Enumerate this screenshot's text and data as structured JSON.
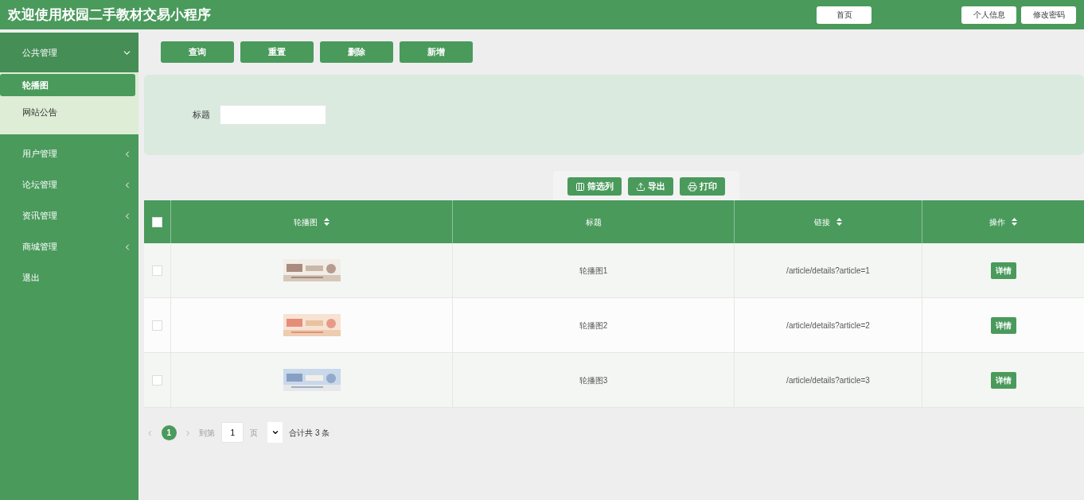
{
  "header": {
    "title": "欢迎使用校园二手教材交易小程序",
    "home_button": "首页",
    "profile_button": "个人信息",
    "password_button": "修改密码"
  },
  "sidebar": {
    "items": [
      {
        "label": "公共管理",
        "kind": "group",
        "expanded": true,
        "children": [
          {
            "label": "轮播图",
            "selected": true
          },
          {
            "label": "网站公告",
            "selected": false
          }
        ]
      },
      {
        "label": "用户管理",
        "kind": "group",
        "expanded": false
      },
      {
        "label": "论坛管理",
        "kind": "group",
        "expanded": false
      },
      {
        "label": "资讯管理",
        "kind": "group",
        "expanded": false
      },
      {
        "label": "商城管理",
        "kind": "group",
        "expanded": false
      },
      {
        "label": "退出",
        "kind": "link"
      }
    ]
  },
  "actions": [
    "查询",
    "重置",
    "删除",
    "新增"
  ],
  "search": {
    "label": "标题"
  },
  "tools": [
    {
      "label": "筛选列",
      "kind": "columns"
    },
    {
      "label": "导出",
      "kind": "export"
    },
    {
      "label": "打印",
      "kind": "print"
    }
  ],
  "table": {
    "select_all_checked": false,
    "columns": [
      {
        "label": "轮播图",
        "sortable": true
      },
      {
        "label": "标题",
        "sortable": false
      },
      {
        "label": "链接",
        "sortable": true
      },
      {
        "label": "操作",
        "sortable": true
      }
    ],
    "rows": [
      {
        "checked": false,
        "title": "轮播图1",
        "link": "/article/details?article=1",
        "action": "详情"
      },
      {
        "checked": false,
        "title": "轮播图2",
        "link": "/article/details?article=2",
        "action": "详情"
      },
      {
        "checked": false,
        "title": "轮播图3",
        "link": "/article/details?article=3",
        "action": "详情"
      }
    ]
  },
  "pagination": {
    "prev": "‹",
    "pages": [
      {
        "label": "1",
        "selected": true
      }
    ],
    "next": "›",
    "goto_label": "到第",
    "goto_value": "1",
    "page_label": "页",
    "total": "合计共 3 条"
  }
}
